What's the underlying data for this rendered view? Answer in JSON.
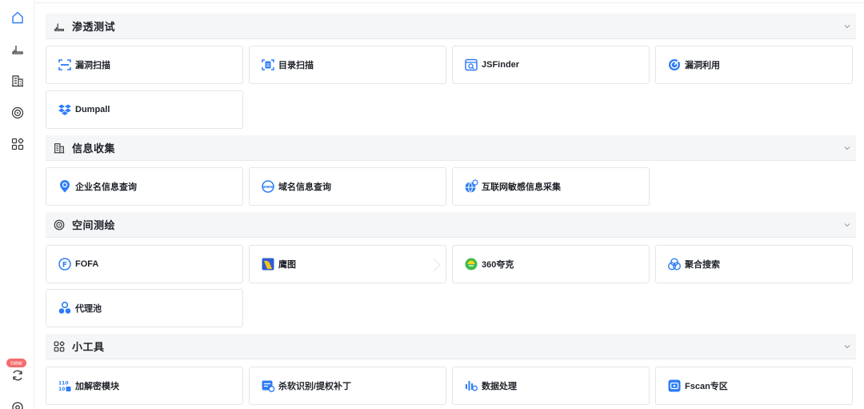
{
  "sidebar": {
    "items": [
      {
        "icon": "home-icon"
      },
      {
        "icon": "pentest-icon"
      },
      {
        "icon": "building-icon"
      },
      {
        "icon": "radar-icon"
      },
      {
        "icon": "apps-icon"
      },
      {
        "icon": "refresh-icon",
        "badge": "new"
      },
      {
        "icon": "settings-icon"
      }
    ]
  },
  "accent_color": "#2e7cf6",
  "sections": [
    {
      "title": "渗透测试",
      "icon": "pentest-icon",
      "cards": [
        {
          "label": "漏洞扫描",
          "icon": "scan-icon"
        },
        {
          "label": "目录扫描",
          "icon": "directory-icon"
        },
        {
          "label": "JSFinder",
          "icon": "jsfinder-icon"
        },
        {
          "label": "漏洞利用",
          "icon": "exploit-icon"
        },
        {
          "label": "Dumpall",
          "icon": "dropbox-icon"
        }
      ]
    },
    {
      "title": "信息收集",
      "icon": "building-icon",
      "cards": [
        {
          "label": "企业名信息查询",
          "icon": "location-icon"
        },
        {
          "label": "域名信息查询",
          "icon": "domain-icon"
        },
        {
          "label": "互联网敏感信息采集",
          "icon": "globe-icon"
        }
      ]
    },
    {
      "title": "空间测绘",
      "icon": "radar-icon",
      "cards": [
        {
          "label": "FOFA",
          "icon": "fofa-icon"
        },
        {
          "label": "鹰图",
          "icon": "hunter-icon"
        },
        {
          "label": "360夸克",
          "icon": "quake-icon"
        },
        {
          "label": "聚合搜索",
          "icon": "aggregate-icon"
        },
        {
          "label": "代理池",
          "icon": "proxy-icon"
        }
      ]
    },
    {
      "title": "小工具",
      "icon": "apps-icon",
      "cards": [
        {
          "label": "加解密模块",
          "icon": "binary-icon"
        },
        {
          "label": "杀软识别/提权补丁",
          "icon": "antivirus-icon"
        },
        {
          "label": "数据处理",
          "icon": "data-icon"
        },
        {
          "label": "Fscan专区",
          "icon": "fscan-icon"
        }
      ]
    }
  ]
}
